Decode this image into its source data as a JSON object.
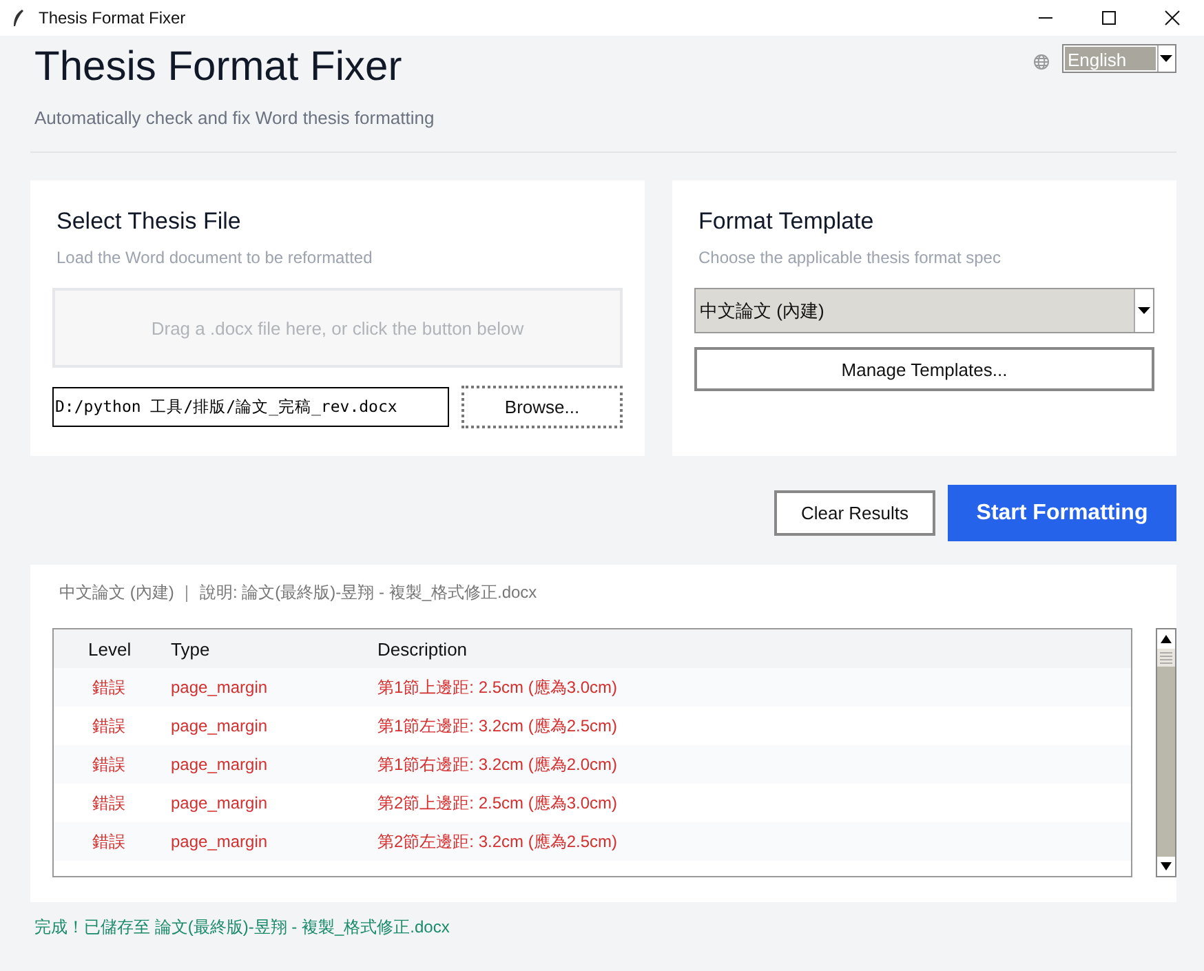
{
  "window": {
    "title": "Thesis Format Fixer"
  },
  "header": {
    "title": "Thesis Format Fixer",
    "subtitle": "Automatically check and fix Word thesis formatting",
    "language": "English"
  },
  "file_card": {
    "title": "Select Thesis File",
    "subtitle": "Load the Word document to be reformatted",
    "drop_hint": "Drag a .docx file here, or click the button below",
    "path": "D:/python 工具/排版/論文_完稿_rev.docx",
    "browse_button": "Browse..."
  },
  "template_card": {
    "title": "Format Template",
    "subtitle": "Choose the applicable thesis format spec",
    "template": "中文論文 (內建)",
    "manage_button": "Manage Templates..."
  },
  "actions": [
    {
      "label": "Clear Results",
      "kind": "secondary"
    },
    {
      "label": "Start Formatting",
      "kind": "primary"
    }
  ],
  "results": {
    "summary": "中文論文 (內建) ｜ 說明: 論文(最終版)-昱翔 - 複製_格式修正.docx",
    "columns": [
      "Level",
      "Type",
      "Description"
    ],
    "rows": [
      {
        "level": "錯誤",
        "type": "page_margin",
        "description": "第1節上邊距: 2.5cm (應為3.0cm)"
      },
      {
        "level": "錯誤",
        "type": "page_margin",
        "description": "第1節左邊距: 3.2cm (應為2.5cm)"
      },
      {
        "level": "錯誤",
        "type": "page_margin",
        "description": "第1節右邊距: 3.2cm (應為2.0cm)"
      },
      {
        "level": "錯誤",
        "type": "page_margin",
        "description": "第2節上邊距: 2.5cm (應為3.0cm)"
      },
      {
        "level": "錯誤",
        "type": "page_margin",
        "description": "第2節左邊距: 3.2cm (應為2.5cm)"
      }
    ]
  },
  "status_bar": "完成！已儲存至 論文(最終版)-昱翔 - 複製_格式修正.docx"
}
